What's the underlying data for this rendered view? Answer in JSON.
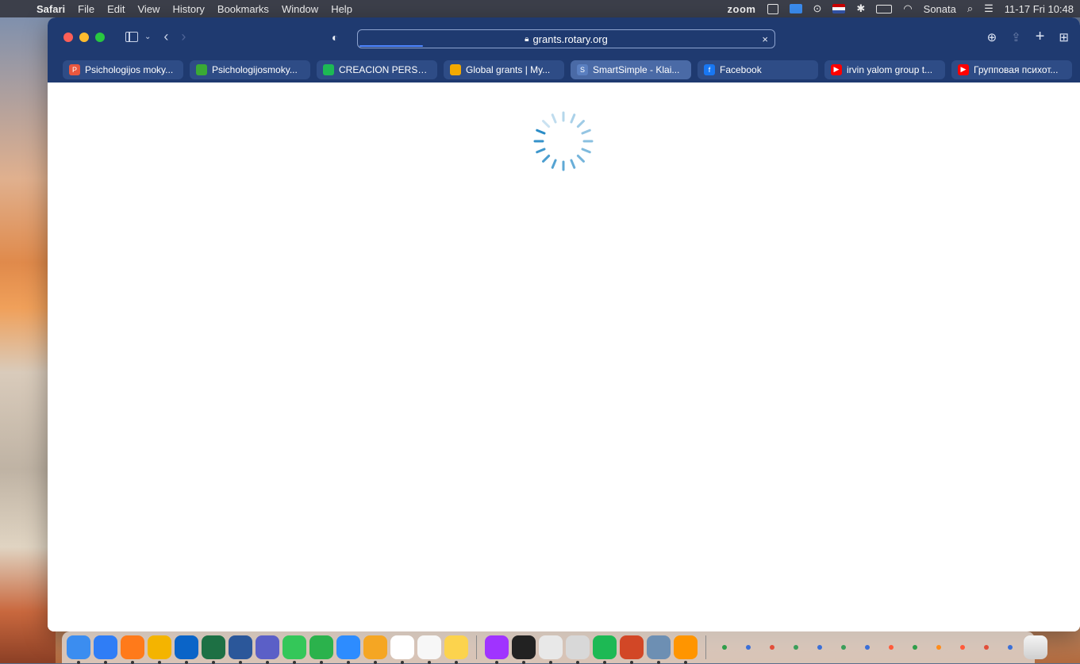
{
  "menubar": {
    "app": "Safari",
    "items": [
      "File",
      "Edit",
      "View",
      "History",
      "Bookmarks",
      "Window",
      "Help"
    ],
    "status": {
      "zoom": "zoom",
      "user": "Sonata",
      "datetime": "11-17 Fri 10:48"
    }
  },
  "toolbar": {
    "url": "grants.rotary.org",
    "clear_icon": "×"
  },
  "tabs": [
    {
      "label": "Psichologijos moky...",
      "color": "#e9573f",
      "icon": "P"
    },
    {
      "label": "Psichologijosmoky...",
      "color": "#3aaa35",
      "icon": ""
    },
    {
      "label": "CREACION PERSO...",
      "color": "#1db954",
      "icon": ""
    },
    {
      "label": "Global grants | My...",
      "color": "#f2a900",
      "icon": ""
    },
    {
      "label": "SmartSimple - Klai...",
      "color": "#5a7fc0",
      "icon": "S",
      "active": true
    },
    {
      "label": "Facebook",
      "color": "#1877f2",
      "icon": "f"
    },
    {
      "label": "irvin yalom group t...",
      "color": "#ff0000",
      "icon": "▶"
    },
    {
      "label": "Групповая психот...",
      "color": "#ff0000",
      "icon": "▶"
    }
  ],
  "dock": {
    "apps": [
      {
        "name": "finder",
        "color": "#3b8df0"
      },
      {
        "name": "safari",
        "color": "#2f7df6"
      },
      {
        "name": "firefox",
        "color": "#ff7a1a"
      },
      {
        "name": "chrome",
        "color": "#f4b400"
      },
      {
        "name": "outlook",
        "color": "#0a64c8"
      },
      {
        "name": "excel",
        "color": "#1d7044"
      },
      {
        "name": "word",
        "color": "#2b579a"
      },
      {
        "name": "teams",
        "color": "#5b5fc7"
      },
      {
        "name": "messages",
        "color": "#34c759"
      },
      {
        "name": "facetime",
        "color": "#2bb24c"
      },
      {
        "name": "zoom",
        "color": "#2d8cff"
      },
      {
        "name": "photos",
        "color": "#f5a623"
      },
      {
        "name": "calendar",
        "color": "#ffffff"
      },
      {
        "name": "reminders",
        "color": "#f7f7f7"
      },
      {
        "name": "notes",
        "color": "#fcd34d"
      },
      {
        "name": "messenger",
        "color": "#a033ff"
      },
      {
        "name": "terminal",
        "color": "#222222"
      },
      {
        "name": "script-editor",
        "color": "#e8e8e8"
      },
      {
        "name": "preview",
        "color": "#d8d8d8"
      },
      {
        "name": "spotify",
        "color": "#1db954"
      },
      {
        "name": "powerpoint",
        "color": "#d24726"
      },
      {
        "name": "system-prefs",
        "color": "#6d8fb3"
      },
      {
        "name": "books",
        "color": "#ff9500"
      }
    ],
    "minis": [
      "#2e9e4a",
      "#3a6fd8",
      "#e24e3a",
      "#3a9e5a",
      "#3a6fd8",
      "#3a9e5a",
      "#3a6fd8",
      "#ff5a3a",
      "#2e9e4a",
      "#ff8c1a",
      "#ff5a3a",
      "#e24e3a",
      "#3a6fd8"
    ]
  }
}
